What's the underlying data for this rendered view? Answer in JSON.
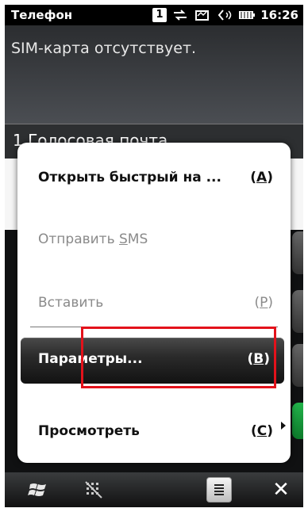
{
  "status_bar": {
    "title": "Телефон",
    "badge": "1",
    "time": "16:26",
    "icons": [
      "connectivity-icon",
      "message-icon",
      "volume-icon",
      "battery-icon"
    ]
  },
  "info": {
    "message": "SIM-карта отсутствует."
  },
  "list": {
    "first_item": "1  Голосовая почта"
  },
  "menu": {
    "items": [
      {
        "label": "Открыть быстрый на ...",
        "shortcut_pre": "(",
        "shortcut_key": "A",
        "shortcut_post": ")",
        "enabled": true
      },
      {
        "label_pre": "Отправить ",
        "label_key": "S",
        "label_post": "MS",
        "enabled": false
      },
      {
        "label": "Вставить",
        "shortcut_pre": "(",
        "shortcut_key": "P",
        "shortcut_post": ")",
        "enabled": false
      },
      {
        "label": "Параметры...",
        "shortcut_pre": "(",
        "shortcut_key": "B",
        "shortcut_post": ")",
        "enabled": true,
        "selected": true
      },
      {
        "label": "Просмотреть",
        "shortcut_pre": "(",
        "shortcut_key": "C",
        "shortcut_post": ")",
        "enabled": true,
        "has_submenu": true
      }
    ]
  },
  "bottom_bar": {
    "icons": [
      "windows-start-icon",
      "keyboard-grid-icon",
      "menu-icon",
      "close-icon"
    ],
    "close_glyph": "✕"
  },
  "colors": {
    "highlight": "#e3121b",
    "selected_bg": "#1e1e1e",
    "disabled_text": "#8a8a8a"
  }
}
